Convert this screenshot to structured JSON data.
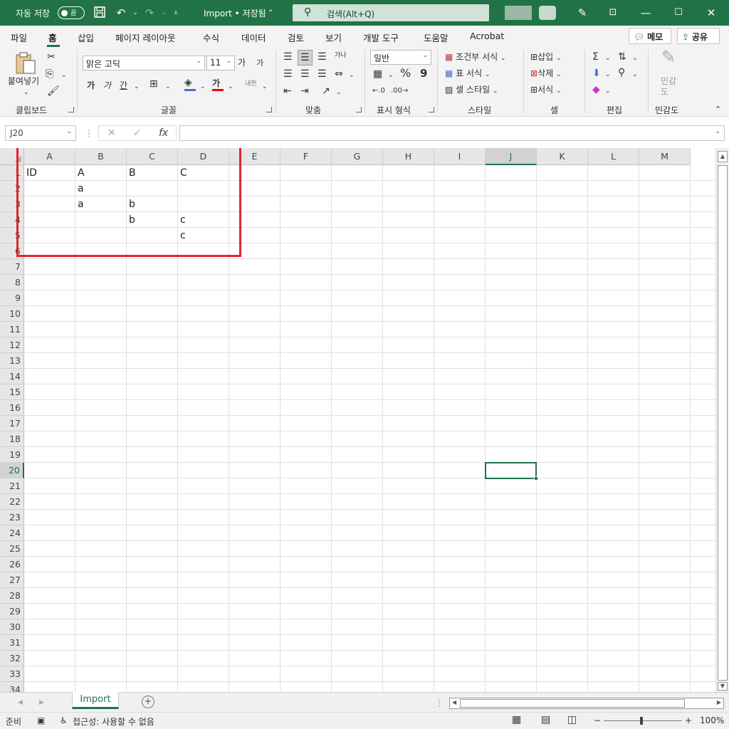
{
  "titlebar": {
    "autosave_label": "자동 저장",
    "autosave_state": "끔",
    "doc_title": "Import • 저장됨",
    "doc_title_arrow": "⌄",
    "search_placeholder": "검색(Alt+Q)"
  },
  "ribbon_tabs": [
    "파일",
    "홈",
    "삽입",
    "페이지 레이아웃",
    "수식",
    "데이터",
    "검토",
    "보기",
    "개발 도구",
    "도움말",
    "Acrobat"
  ],
  "ribbon_buttons": {
    "memo": "메모",
    "share": "공유"
  },
  "ribbon": {
    "clipboard": {
      "paste_label": "붙여넣기",
      "group_label": "클립보드"
    },
    "font": {
      "font_name": "맑은 고딕",
      "font_size": "11",
      "group_label": "글꼴",
      "grow": "가",
      "shrink": "가",
      "bold": "가",
      "italic": "가",
      "underline": "간",
      "color_letter": "가",
      "phonetic": "내천"
    },
    "alignment": {
      "group_label": "맞춤",
      "wrap": "가나"
    },
    "number": {
      "format": "일반",
      "group_label": "표시 형식",
      "percent": "%",
      "comma": "9"
    },
    "styles": {
      "conditional": "조건부 서식",
      "table": "표 서식",
      "cell_style": "셀 스타일",
      "group_label": "스타일"
    },
    "cells": {
      "insert": "삽입",
      "delete": "삭제",
      "format": "서식",
      "group_label": "셀"
    },
    "editing": {
      "group_label": "편집"
    },
    "sensitivity": {
      "label_line1": "민감",
      "label_line2": "도",
      "group_label": "민감도"
    }
  },
  "formula_bar": {
    "name_box": "J20",
    "cancel": "✕",
    "enter": "✓",
    "fx": "fx",
    "value": ""
  },
  "grid": {
    "columns": [
      "A",
      "B",
      "C",
      "D",
      "E",
      "F",
      "G",
      "H",
      "I",
      "J",
      "K",
      "L",
      "M"
    ],
    "selected_column": "J",
    "selected_row": "20",
    "rows": [
      "1",
      "2",
      "3",
      "4",
      "5",
      "6",
      "7",
      "8",
      "9",
      "10",
      "11",
      "12",
      "13",
      "14",
      "15",
      "16",
      "17",
      "18",
      "19",
      "20",
      "21",
      "22",
      "23",
      "24",
      "25",
      "26",
      "27",
      "28",
      "29",
      "30",
      "31",
      "32",
      "33",
      "34"
    ],
    "cells": {
      "A1": "ID",
      "B1": "A",
      "C1": "B",
      "D1": "C",
      "B2": "a",
      "B3": "a",
      "C3": "b",
      "C4": "b",
      "D4": "c",
      "D5": "c"
    },
    "active_cell": "J20",
    "highlight_color": "#e0262d"
  },
  "sheetbar": {
    "sheet_name": "Import",
    "add_sheet": "+"
  },
  "statusbar": {
    "ready": "준비",
    "accessibility": "접근성: 사용할 수 없음",
    "zoom": "100%"
  },
  "colors": {
    "accent": "#217346"
  }
}
